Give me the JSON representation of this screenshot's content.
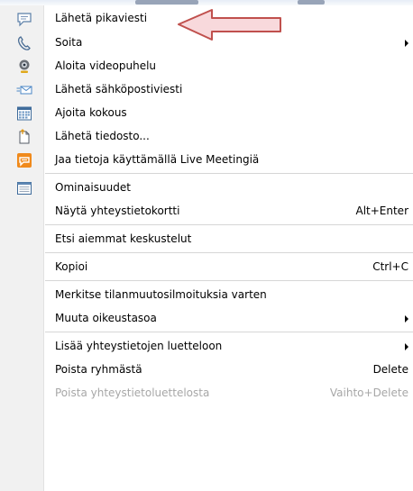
{
  "menu": {
    "items": [
      {
        "id": "send-im",
        "label": "Lähetä pikaviesti",
        "shortcut": "",
        "submenu": false,
        "disabled": false,
        "icon": "chat-bubble-icon"
      },
      {
        "id": "call",
        "label": "Soita",
        "shortcut": "",
        "submenu": true,
        "disabled": false,
        "icon": "phone-handset-icon"
      },
      {
        "id": "video-call",
        "label": "Aloita videopuhelu",
        "shortcut": "",
        "submenu": false,
        "disabled": false,
        "icon": "webcam-icon"
      },
      {
        "id": "send-email",
        "label": "Lähetä sähköpostiviesti",
        "shortcut": "",
        "submenu": false,
        "disabled": false,
        "icon": "email-icon"
      },
      {
        "id": "schedule-meeting",
        "label": "Ajoita kokous",
        "shortcut": "",
        "submenu": false,
        "disabled": false,
        "icon": "calendar-icon"
      },
      {
        "id": "send-file",
        "label": "Lähetä tiedosto...",
        "shortcut": "",
        "submenu": false,
        "disabled": false,
        "icon": "file-transfer-icon"
      },
      {
        "id": "live-meeting",
        "label": "Jaa tietoja käyttämällä Live Meetingiä",
        "shortcut": "",
        "submenu": false,
        "disabled": false,
        "icon": "live-meeting-icon"
      },
      {
        "id": "properties",
        "label": "Ominaisuudet",
        "shortcut": "",
        "submenu": false,
        "disabled": false,
        "icon": "properties-icon"
      },
      {
        "id": "contact-card",
        "label": "Näytä yhteystietokortti",
        "shortcut": "Alt+Enter",
        "submenu": false,
        "disabled": false,
        "icon": ""
      },
      {
        "id": "find-history",
        "label": "Etsi aiemmat keskustelut",
        "shortcut": "",
        "submenu": false,
        "disabled": false,
        "icon": ""
      },
      {
        "id": "copy",
        "label": "Kopioi",
        "shortcut": "Ctrl+C",
        "submenu": false,
        "disabled": false,
        "icon": ""
      },
      {
        "id": "tag-status",
        "label": "Merkitse tilanmuutosilmoituksia varten",
        "shortcut": "",
        "submenu": false,
        "disabled": false,
        "icon": ""
      },
      {
        "id": "access-level",
        "label": "Muuta oikeustasoa",
        "shortcut": "",
        "submenu": true,
        "disabled": false,
        "icon": ""
      },
      {
        "id": "add-to-list",
        "label": "Lisää yhteystietojen luetteloon",
        "shortcut": "",
        "submenu": true,
        "disabled": false,
        "icon": ""
      },
      {
        "id": "remove-group",
        "label": "Poista ryhmästä",
        "shortcut": "Delete",
        "submenu": false,
        "disabled": false,
        "icon": ""
      },
      {
        "id": "remove-contacts",
        "label": "Poista yhteystietoluettelosta",
        "shortcut": "Vaihto+Delete",
        "submenu": false,
        "disabled": true,
        "icon": ""
      }
    ]
  },
  "colors": {
    "gutter": "#f1f1f1",
    "separator": "#d6d6d6",
    "disabled_text": "#a7a7a7",
    "callout_fill": "#f8d9dc",
    "callout_stroke": "#c0504d"
  }
}
